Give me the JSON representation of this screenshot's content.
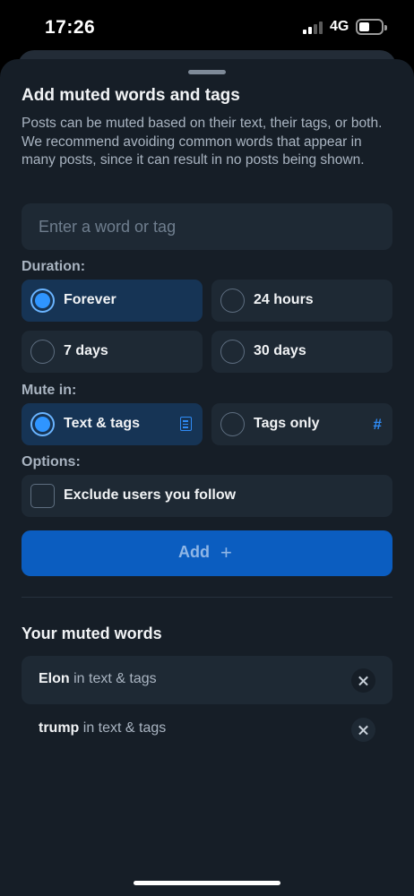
{
  "status_bar": {
    "time": "17:26",
    "network": "4G",
    "signal_bars_active": 2,
    "battery_level": 0.35
  },
  "sheet": {
    "title": "Add muted words and tags",
    "description": "Posts can be muted based on their text, their tags, or both. We recommend avoiding common words that appear in many posts, since it can result in no posts being shown.",
    "input": {
      "placeholder": "Enter a word or tag",
      "value": ""
    },
    "duration": {
      "label": "Duration:",
      "options": [
        {
          "label": "Forever",
          "selected": true
        },
        {
          "label": "24 hours",
          "selected": false
        },
        {
          "label": "7 days",
          "selected": false
        },
        {
          "label": "30 days",
          "selected": false
        }
      ]
    },
    "mute_in": {
      "label": "Mute in:",
      "options": [
        {
          "label": "Text & tags",
          "selected": true,
          "icon": "document-icon"
        },
        {
          "label": "Tags only",
          "selected": false,
          "icon": "hash-icon",
          "icon_glyph": "#"
        }
      ]
    },
    "options": {
      "label": "Options:",
      "exclude_following": {
        "label": "Exclude users you follow",
        "checked": false
      }
    },
    "add_button": {
      "label": "Add",
      "icon": "plus-icon",
      "glyph": "+"
    },
    "muted_words": {
      "title": "Your muted words",
      "items": [
        {
          "word": "Elon",
          "scope": "in text & tags"
        },
        {
          "word": "trump",
          "scope": "in text & tags"
        }
      ]
    }
  },
  "colors": {
    "background": "#161e27",
    "card": "#1e2934",
    "selected_card": "#163455",
    "accent": "#2f95ff",
    "button": "#0b5dc0"
  }
}
